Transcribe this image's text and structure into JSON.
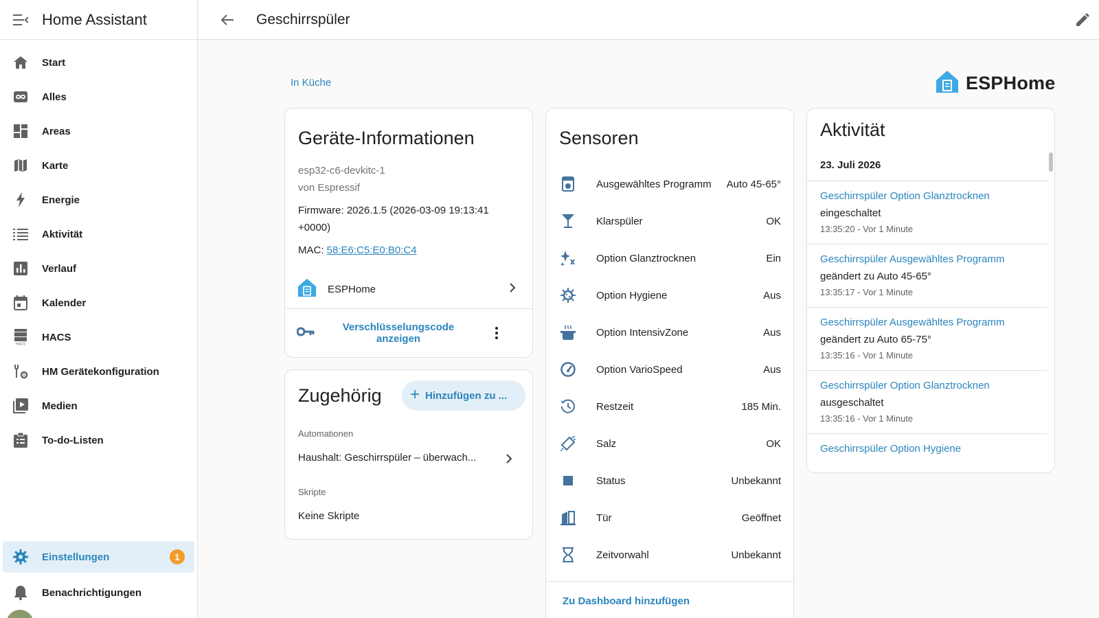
{
  "app": {
    "title": "Home Assistant"
  },
  "sidebar": {
    "items": [
      {
        "label": "Start",
        "icon": "home-icon"
      },
      {
        "label": "Alles",
        "icon": "infinity-icon"
      },
      {
        "label": "Areas",
        "icon": "dashboard-icon"
      },
      {
        "label": "Karte",
        "icon": "map-icon"
      },
      {
        "label": "Energie",
        "icon": "lightning-icon"
      },
      {
        "label": "Aktivität",
        "icon": "list-icon"
      },
      {
        "label": "Verlauf",
        "icon": "chart-icon"
      },
      {
        "label": "Kalender",
        "icon": "calendar-icon"
      },
      {
        "label": "HACS",
        "icon": "hacs-icon"
      },
      {
        "label": "HM Gerätekonfiguration",
        "icon": "wrench-gear-icon"
      },
      {
        "label": "Medien",
        "icon": "media-icon"
      },
      {
        "label": "To-do-Listen",
        "icon": "clipboard-list-icon"
      }
    ],
    "settings": {
      "label": "Einstellungen",
      "badge": "1"
    },
    "notifications": {
      "label": "Benachrichtigungen"
    }
  },
  "header": {
    "title": "Geschirrspüler"
  },
  "breadcrumb": "In Küche",
  "brand": "ESPHome",
  "device_info": {
    "title": "Geräte-Informationen",
    "model": "esp32-c6-devkitc-1",
    "manufacturer": "von Espressif",
    "firmware_line1": "Firmware: 2026.1.5 (2026-03-09 19:13:41",
    "firmware_line2": "+0000)",
    "mac_label": "MAC: ",
    "mac_value": "58:E6:C5:E0:B0:C4",
    "integration": "ESPHome",
    "action_line1": "Verschlüsselungscode",
    "action_line2": "anzeigen"
  },
  "related": {
    "title": "Zugehörig",
    "add_label": "Hinzufügen zu ...",
    "automations_label": "Automationen",
    "automation_item": "Haushalt: Geschirrspüler – überwach...",
    "scripts_label": "Skripte",
    "scripts_empty": "Keine Skripte"
  },
  "sensors": {
    "title": "Sensoren",
    "rows": [
      {
        "name": "Ausgewähltes Programm",
        "value": "Auto 45-65°",
        "icon": "program-icon"
      },
      {
        "name": "Klarspüler",
        "value": "OK",
        "icon": "glass-icon"
      },
      {
        "name": "Option Glanztrocknen",
        "value": "Ein",
        "icon": "sparkle-icon"
      },
      {
        "name": "Option Hygiene",
        "value": "Aus",
        "icon": "virus-icon"
      },
      {
        "name": "Option IntensivZone",
        "value": "Aus",
        "icon": "pot-steam-icon"
      },
      {
        "name": "Option VarioSpeed",
        "value": "Aus",
        "icon": "speedometer-icon"
      },
      {
        "name": "Restzeit",
        "value": "185 Min.",
        "icon": "history-icon"
      },
      {
        "name": "Salz",
        "value": "OK",
        "icon": "shaker-icon"
      },
      {
        "name": "Status",
        "value": "Unbekannt",
        "icon": "stop-icon"
      },
      {
        "name": "Tür",
        "value": "Geöffnet",
        "icon": "door-open-icon"
      },
      {
        "name": "Zeitvorwahl",
        "value": "Unbekannt",
        "icon": "hourglass-icon"
      }
    ],
    "footer_link": "Zu Dashboard hinzufügen"
  },
  "activity": {
    "title": "Aktivität",
    "date": "23. Juli 2026",
    "entries": [
      {
        "entity": "Geschirrspüler Option Glanztrocknen",
        "message": "eingeschaltet",
        "time": "13:35:20 - Vor 1 Minute"
      },
      {
        "entity": "Geschirrspüler Ausgewähltes Programm",
        "message": "geändert zu Auto 45-65°",
        "time": "13:35:17 - Vor 1 Minute"
      },
      {
        "entity": "Geschirrspüler Ausgewähltes Programm",
        "message": "geändert zu Auto 65-75°",
        "time": "13:35:16 - Vor 1 Minute"
      },
      {
        "entity": "Geschirrspüler Option Glanztrocknen",
        "message": "ausgeschaltet",
        "time": "13:35:16 - Vor 1 Minute"
      },
      {
        "entity": "Geschirrspüler Option Hygiene",
        "message": "",
        "time": ""
      }
    ]
  },
  "colors": {
    "accent": "#2a85bd",
    "icon": "#44739e",
    "badge": "#f39c2a",
    "esphome_blue": "#3da8e4"
  }
}
